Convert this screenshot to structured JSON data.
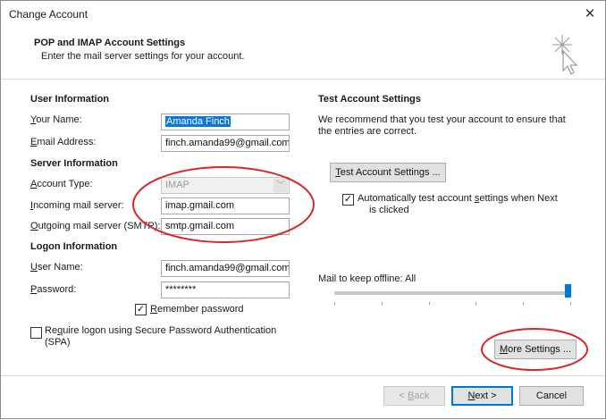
{
  "window": {
    "title": "Change Account"
  },
  "header": {
    "title": "POP and IMAP Account Settings",
    "subtitle": "Enter the mail server settings for your account."
  },
  "user_info": {
    "heading": "User Information",
    "your_name_label_key": "Y",
    "your_name_label_rest": "our Name:",
    "your_name_value": "Amanda Finch",
    "email_label_key": "E",
    "email_label_rest": "mail Address:",
    "email_value": "finch.amanda99@gmail.com"
  },
  "server_info": {
    "heading": "Server Information",
    "account_type_label_key": "A",
    "account_type_label_rest": "ccount Type:",
    "account_type_value": "IMAP",
    "incoming_label_key": "I",
    "incoming_label_rest": "ncoming mail server:",
    "incoming_value": "imap.gmail.com",
    "outgoing_label_key": "O",
    "outgoing_label_rest": "utgoing mail server (SMTP):",
    "outgoing_value": "smtp.gmail.com"
  },
  "logon_info": {
    "heading": "Logon Information",
    "username_label_key": "U",
    "username_label_rest": "ser Name:",
    "username_value": "finch.amanda99@gmail.com",
    "password_label_key": "P",
    "password_label_rest": "assword:",
    "password_value": "********",
    "remember_key": "R",
    "remember_rest": "emember password",
    "remember_checked": true,
    "spa_pre": "Re",
    "spa_key": "q",
    "spa_rest": "uire logon using Secure Password Authentication",
    "spa_line2": "(SPA)",
    "spa_checked": false
  },
  "test_settings": {
    "heading": "Test Account Settings",
    "description_line1": "We recommend that you test your account to ensure that",
    "description_line2": "the entries are correct.",
    "test_button_key": "T",
    "test_button_rest": "est Account Settings ...",
    "auto_test_pre": "Automatically test account ",
    "auto_test_key": "s",
    "auto_test_rest": "ettings when Next",
    "auto_test_line2": "is clicked",
    "auto_test_checked": true
  },
  "offline": {
    "label": "Mail to keep offline:",
    "value": "All",
    "slider_fraction": 1.0
  },
  "buttons": {
    "more_settings_key": "M",
    "more_settings_rest": "ore Settings ...",
    "back_pre": "< ",
    "back_key": "B",
    "back_rest": "ack",
    "next_key": "N",
    "next_rest": "ext >",
    "cancel": "Cancel"
  },
  "annotation_color": "#d9262b",
  "accent_color": "#0078d7",
  "icons": {
    "close": "close-icon",
    "wizard": "wizard-sparkle-cursor-icon",
    "check": "checkmark-icon",
    "dropdown": "chevron-down-icon"
  }
}
